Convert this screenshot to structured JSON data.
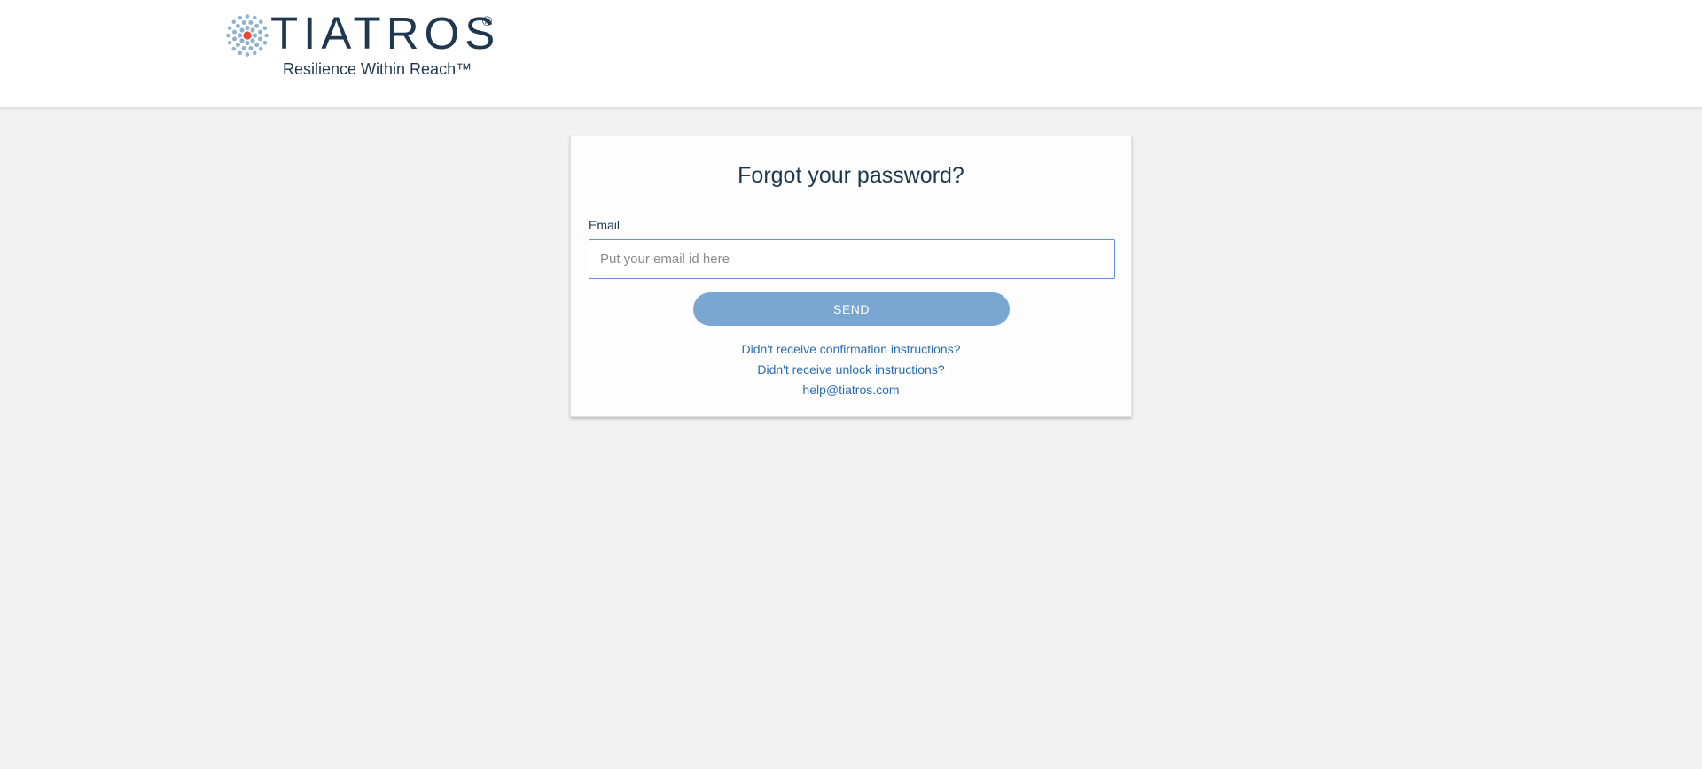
{
  "brand": {
    "name": "TIATROS",
    "registered_mark": "®",
    "tagline": "Resilience Within Reach™",
    "colors": {
      "navy": "#1f3850",
      "dot_blue": "#8fb3cf",
      "dot_red": "#e8473a"
    },
    "logo_icon": "dot-burst-icon"
  },
  "form": {
    "title": "Forgot your password?",
    "email_label": "Email",
    "email_value": "",
    "email_placeholder": "Put your email id here",
    "send_label": "SEND",
    "send_color": "#7aa7d1"
  },
  "links": {
    "confirmation": "Didn't receive confirmation instructions?",
    "unlock": "Didn't receive unlock instructions?",
    "help_email": "help@tiatros.com",
    "link_color": "#2a6db0"
  },
  "colors": {
    "page_background": "#f2f2f2",
    "header_background": "#ffffff",
    "input_focus_border": "#5d8fe0"
  }
}
